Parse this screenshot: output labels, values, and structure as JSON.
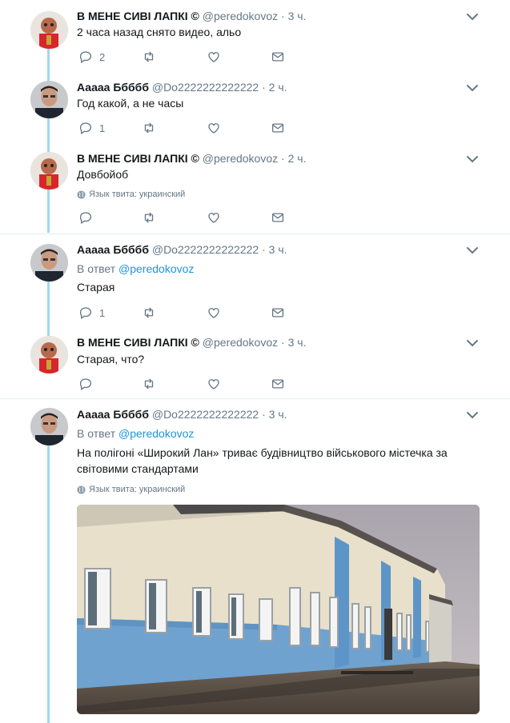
{
  "tweets": [
    {
      "name": "В МЕНЕ СИВІ ЛАПКІ ©",
      "handle": "@peredokovoz",
      "time": "3 ч.",
      "text": "2 часа назад снято видео, альо",
      "replies": "2"
    },
    {
      "name": "Ааааа Ббббб",
      "handle": "@Do2222222222222",
      "time": "2 ч.",
      "text": "Год какой, а не часы",
      "replies": "1"
    },
    {
      "name": "В МЕНЕ СИВІ ЛАПКІ ©",
      "handle": "@peredokovoz",
      "time": "2 ч.",
      "text": "Довбойоб",
      "lang": "Язык твита: украинский"
    },
    {
      "name": "Ааааа Ббббб",
      "handle": "@Do2222222222222",
      "time": "3 ч.",
      "reply_to_prefix": "В ответ",
      "reply_to_handle": "@peredokovoz",
      "text": "Старая",
      "replies": "1"
    },
    {
      "name": "В МЕНЕ СИВІ ЛАПКІ ©",
      "handle": "@peredokovoz",
      "time": "3 ч.",
      "text": "Старая, что?"
    },
    {
      "name": "Ааааа Ббббб",
      "handle": "@Do2222222222222",
      "time": "3 ч.",
      "reply_to_prefix": "В ответ",
      "reply_to_handle": "@peredokovoz",
      "text": "На полігоні «Широкий Лан» триває будівництво військового містечка за світовими стандартами",
      "lang": "Язык твита: украинский"
    }
  ],
  "separator": "·",
  "icons": {
    "reply": "reply-icon",
    "retweet": "retweet-icon",
    "like": "heart-icon",
    "dm": "envelope-icon",
    "more": "chevron-down-icon",
    "globe": "globe-icon"
  },
  "colors": {
    "thread_line": "#9fd8f5",
    "link": "#1b95e0",
    "muted": "#657786",
    "divider": "#e6ecf0"
  }
}
